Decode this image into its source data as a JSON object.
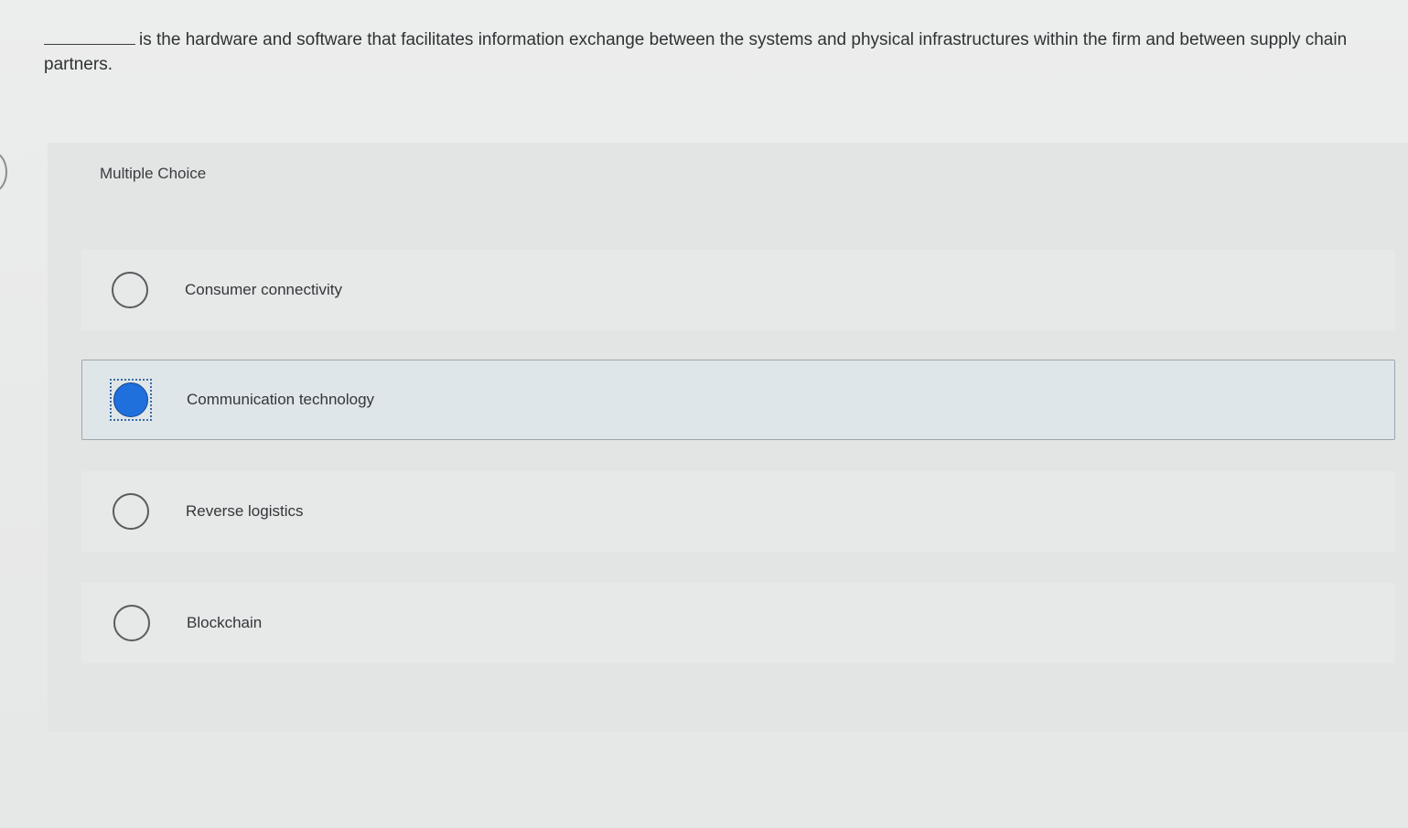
{
  "question": {
    "blank": "",
    "text": "is the hardware and software that facilitates information exchange between the systems and physical infrastructures within the firm and between supply chain partners."
  },
  "quiz": {
    "type_label": "Multiple Choice",
    "selected_index": 1,
    "options": [
      {
        "label": "Consumer connectivity",
        "selected": false
      },
      {
        "label": "Communication technology",
        "selected": true
      },
      {
        "label": "Reverse logistics",
        "selected": false
      },
      {
        "label": "Blockchain",
        "selected": false
      }
    ]
  },
  "colors": {
    "selected_fill": "#1f6fdc",
    "selected_background": "#dfe6e9"
  }
}
